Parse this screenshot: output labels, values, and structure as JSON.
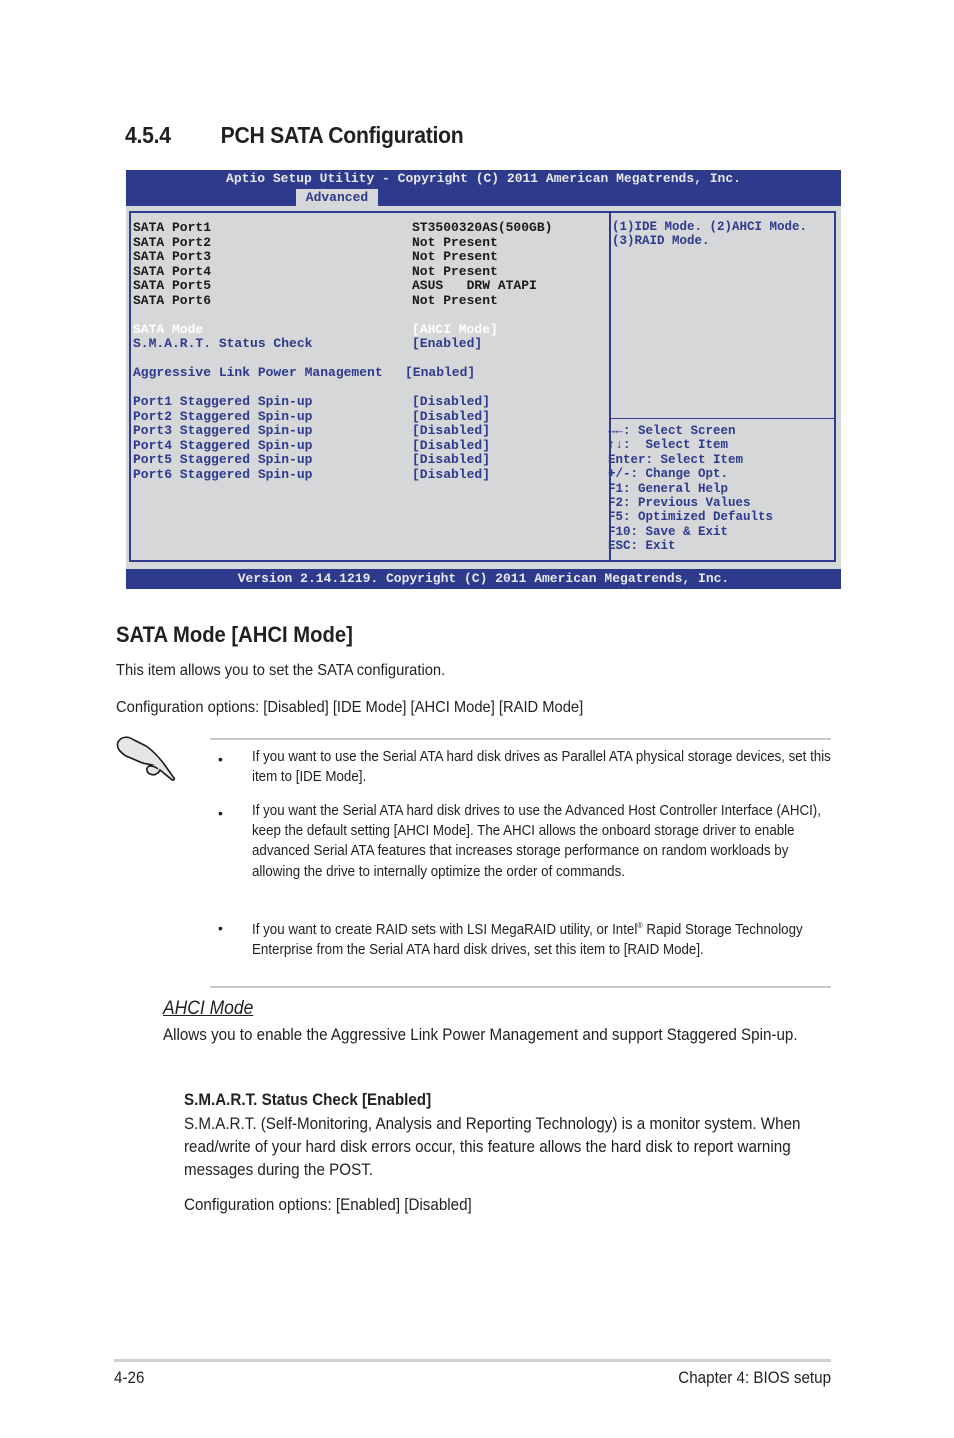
{
  "section": {
    "number": "4.5.4",
    "title": "PCH SATA Configuration"
  },
  "bios": {
    "title": "Aptio Setup Utility - Copyright (C) 2011 American Megatrends, Inc.",
    "active_tab": "Advanced",
    "footer": "Version 2.14.1219. Copyright (C) 2011 American Megatrends, Inc.",
    "ports": [
      {
        "label": "SATA Port1",
        "value": "ST3500320AS(500GB)"
      },
      {
        "label": "SATA Port2",
        "value": "Not Present"
      },
      {
        "label": "SATA Port3",
        "value": "Not Present"
      },
      {
        "label": "SATA Port4",
        "value": "Not Present"
      },
      {
        "label": "SATA Port5",
        "value": "ASUS   DRW ATAPI"
      },
      {
        "label": "SATA Port6",
        "value": "Not Present"
      }
    ],
    "sata_mode": {
      "label": "SATA Mode",
      "value": "[AHCI Mode]"
    },
    "smart": {
      "label": "S.M.A.R.T. Status Check",
      "value": "[Enabled]"
    },
    "alpm": {
      "label": "Aggressive Link Power Management",
      "value": "[Enabled]"
    },
    "spinup": [
      {
        "label": "Port1 Staggered Spin-up",
        "value": "[Disabled]"
      },
      {
        "label": "Port2 Staggered Spin-up",
        "value": "[Disabled]"
      },
      {
        "label": "Port3 Staggered Spin-up",
        "value": "[Disabled]"
      },
      {
        "label": "Port4 Staggered Spin-up",
        "value": "[Disabled]"
      },
      {
        "label": "Port5 Staggered Spin-up",
        "value": "[Disabled]"
      },
      {
        "label": "Port6 Staggered Spin-up",
        "value": "[Disabled]"
      }
    ],
    "help_lines": [
      "(1)IDE Mode. (2)AHCI Mode.",
      "(3)RAID Mode."
    ],
    "keys": [
      "→←: Select Screen",
      "↑↓:  Select Item",
      "Enter: Select Item",
      "+/-: Change Opt.",
      "F1: General Help",
      "F2: Previous Values",
      "F5: Optimized Defaults",
      "F10: Save & Exit",
      "ESC: Exit"
    ]
  },
  "sata_mode_section": {
    "heading": "SATA Mode [AHCI Mode]",
    "intro": "This item allows you to set the SATA configuration.",
    "options": "Configuration options: [Disabled] [IDE Mode] [AHCI Mode] [RAID Mode]"
  },
  "note": {
    "icon": "pointing-hand-icon",
    "bullets": [
      "If you want to use the Serial ATA hard disk drives as Parallel ATA physical storage devices, set this item to [IDE Mode].",
      "If you want the Serial ATA hard disk drives to use the Advanced Host Controller Interface (AHCI), keep the default setting [AHCI Mode]. The AHCI allows the onboard storage driver to enable advanced Serial ATA features that increases storage performance on random workloads by allowing the drive to internally optimize the order of commands.",
      "If you want to create RAID sets with LSI MegaRAID utility, or Intel",
      "Rapid Storage Technology Enterprise from the Serial ATA hard disk drives, set this item to [RAID Mode]."
    ],
    "registered_mark": "®"
  },
  "ahci": {
    "title": "AHCI Mode",
    "text": "Allows you to enable the Aggressive Link Power Management and support Staggered Spin-up."
  },
  "smart_section": {
    "title": "S.M.A.R.T. Status Check [Enabled]",
    "text": "S.M.A.R.T. (Self-Monitoring, Analysis and Reporting Technology) is a monitor system. When read/write of your hard disk errors occur, this feature allows the hard disk to report warning messages during the POST.",
    "options": "Configuration options: [Enabled] [Disabled]"
  },
  "footer": {
    "page": "4-26",
    "chapter": "Chapter 4: BIOS setup"
  }
}
